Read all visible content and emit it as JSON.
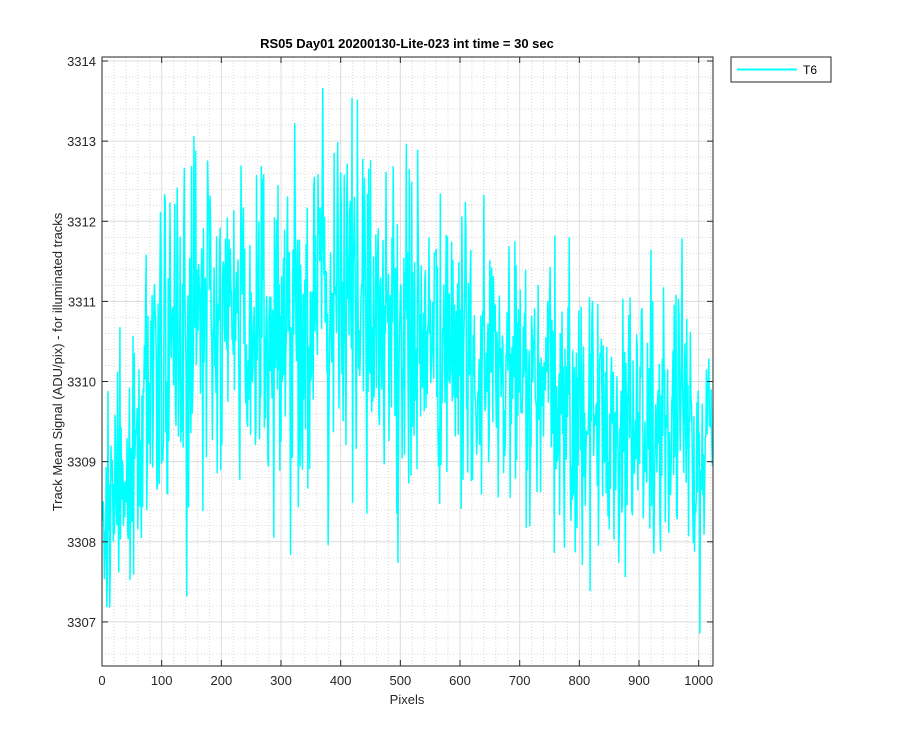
{
  "chart_data": {
    "type": "line",
    "title": "RS05 Day01 20200130-Lite-023 int time = 30 sec",
    "xlabel": "Pixels",
    "ylabel": "Track Mean Signal (ADU/pix) - for illuminated tracks",
    "xlim": [
      0,
      1024
    ],
    "ylim": [
      3306.45,
      3314.05
    ],
    "xticks": [
      0,
      100,
      200,
      300,
      400,
      500,
      600,
      700,
      800,
      900,
      1000
    ],
    "yticks": [
      3307,
      3308,
      3309,
      3310,
      3311,
      3312,
      3313,
      3314
    ],
    "grid": true,
    "minor_grid": true,
    "legend_position": "outside-top-right",
    "series": [
      {
        "name": "T6",
        "color": "#00ffff",
        "points": 1024,
        "trend": {
          "x": [
            0,
            50,
            100,
            150,
            200,
            250,
            300,
            350,
            400,
            450,
            500,
            550,
            600,
            650,
            700,
            750,
            800,
            850,
            900,
            950,
            1000,
            1023
          ],
          "mean": [
            3308.6,
            3308.9,
            3310.4,
            3310.6,
            3310.7,
            3310.8,
            3310.6,
            3310.9,
            3311.1,
            3311.0,
            3310.6,
            3310.5,
            3310.3,
            3310.1,
            3310.0,
            3309.7,
            3309.6,
            3309.5,
            3309.5,
            3309.3,
            3309.2,
            3309.3
          ],
          "min": [
            3306.5,
            3307.1,
            3306.9,
            3307.2,
            3307.9,
            3307.3,
            3307.8,
            3307.5,
            3308.3,
            3308.3,
            3307.0,
            3307.7,
            3308.0,
            3307.5,
            3307.6,
            3307.5,
            3307.5,
            3307.2,
            3306.9,
            3306.9,
            3306.7,
            3307.2
          ],
          "max": [
            3310.5,
            3311.0,
            3312.2,
            3313.5,
            3313.0,
            3313.0,
            3313.9,
            3313.5,
            3313.9,
            3314.0,
            3313.0,
            3312.8,
            3312.2,
            3312.4,
            3312.0,
            3312.0,
            3312.0,
            3311.6,
            3311.8,
            3312.0,
            3311.5,
            3310.8
          ]
        }
      }
    ]
  }
}
